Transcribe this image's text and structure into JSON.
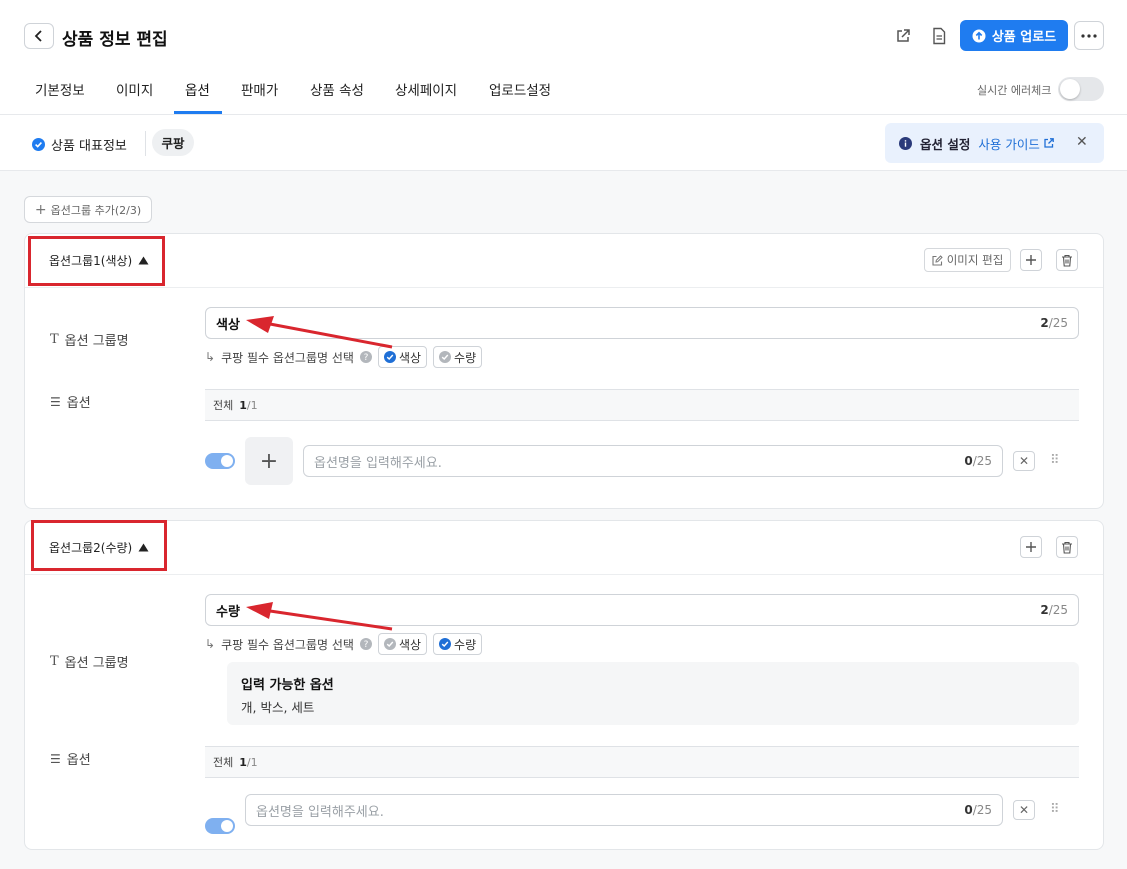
{
  "header": {
    "title": "상품 정보 편집",
    "upload_label": "상품 업로드",
    "tabs": [
      "기본정보",
      "이미지",
      "옵션",
      "판매가",
      "상품 속성",
      "상세페이지",
      "업로드설정"
    ],
    "active_tab": "옵션",
    "realtime_check_label": "실시간 에러체크",
    "realtime_check_on": false
  },
  "subbar": {
    "rep_info_label": "상품 대표정보",
    "marketplace_chip": "쿠팡",
    "guide_title": "옵션 설정",
    "guide_link": "사용 가이드"
  },
  "add_group_label": "옵션그룹 추가(2/3)",
  "groups": [
    {
      "title": "옵션그룹1(색상)",
      "image_edit_label": "이미지 편집",
      "group_name_label": "옵션 그룹명",
      "group_name_value": "색상",
      "group_name_count": "2",
      "group_name_max": "/25",
      "req_label": "쿠팡 필수 옵션그룹명 선택",
      "req_options": [
        {
          "label": "색상",
          "checked": true
        },
        {
          "label": "수량",
          "checked": false
        }
      ],
      "options_label": "옵션",
      "list_all_label": "전체",
      "list_count": "1",
      "list_total": "/1",
      "option_placeholder": "옵션명을 입력해주세요.",
      "option_count": "0",
      "option_max": "/25"
    },
    {
      "title": "옵션그룹2(수량)",
      "group_name_label": "옵션 그룹명",
      "group_name_value": "수량",
      "group_name_count": "2",
      "group_name_max": "/25",
      "req_label": "쿠팡 필수 옵션그룹명 선택",
      "req_options": [
        {
          "label": "색상",
          "checked": false
        },
        {
          "label": "수량",
          "checked": true
        }
      ],
      "avail_title": "입력 가능한 옵션",
      "avail_text": "개, 박스, 세트",
      "options_label": "옵션",
      "list_all_label": "전체",
      "list_count": "1",
      "list_total": "/1",
      "option_placeholder": "옵션명을 입력해주세요.",
      "option_count": "0",
      "option_max": "/25"
    }
  ],
  "colors": {
    "accent": "#1f7cf0",
    "annotation_red": "#d9262e"
  }
}
